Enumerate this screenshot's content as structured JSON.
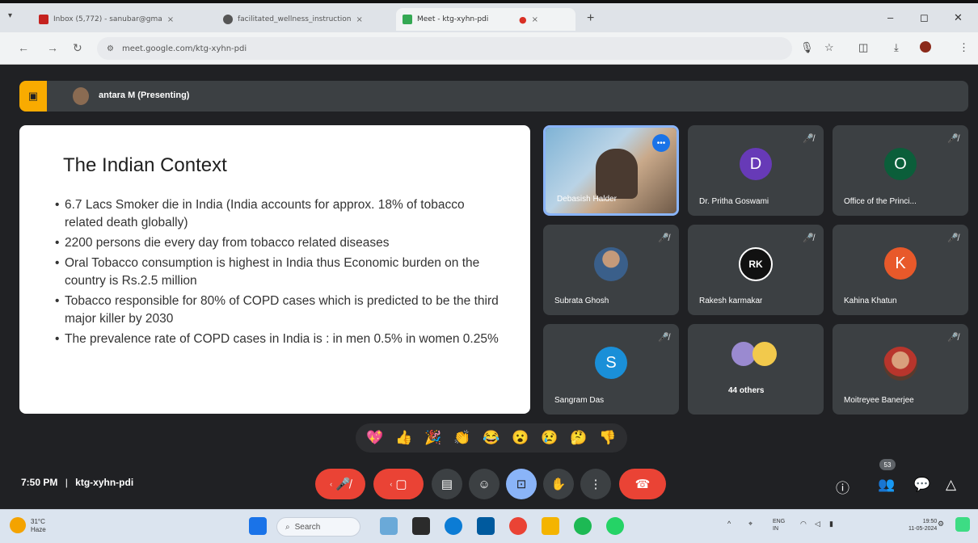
{
  "browser": {
    "tabs": [
      {
        "title": "Inbox (5,772) - sanubar@gma",
        "close": "×",
        "favicon_color": "#c5221f"
      },
      {
        "title": "facilitated_wellness_instruction",
        "close": "×",
        "favicon_color": "#555555"
      },
      {
        "title": "Meet - ktg-xyhn-pdi",
        "close": "×",
        "favicon_color": "#34a853"
      }
    ],
    "new_tab": "+",
    "minimize": "–",
    "restore": "◻",
    "close": "✕",
    "url": "meet.google.com/ktg-xyhn-pdi"
  },
  "meet": {
    "presenter_label": "antara M (Presenting)",
    "slide": {
      "title": "The Indian Context",
      "bullets": [
        "6.7 Lacs Smoker die in India (India accounts for approx. 18% of tobacco related death globally)",
        "2200 persons die every day from tobacco related diseases",
        "Oral Tobacco consumption is highest in India thus Economic burden on the country is Rs.2.5 million",
        "Tobacco responsible for 80% of COPD cases which is predicted to be the third major killer by 2030",
        "The prevalence rate of COPD cases in India is : in men 0.5% in women 0.25%"
      ]
    },
    "participants": [
      {
        "name": "Debasish Halder",
        "avatar": "photo",
        "speaking": true
      },
      {
        "name": "Dr. Pritha Goswami",
        "letter": "D",
        "color": "#673ab7"
      },
      {
        "name": "Office of the Princi...",
        "letter": "O",
        "color": "#0b5e3a"
      },
      {
        "name": "Subrata Ghosh",
        "avatar": "photo"
      },
      {
        "name": "Rakesh karmakar",
        "avatar": "logo",
        "logo_text": "RK"
      },
      {
        "name": "Kahina Khatun",
        "letter": "K",
        "color": "#e8592a"
      },
      {
        "name": "Sangram Das",
        "letter": "S",
        "color": "#1a8fd8"
      },
      {
        "name": "44 others",
        "avatar": "group"
      },
      {
        "name": "Moitreyee Banerjee",
        "avatar": "photo"
      }
    ],
    "reactions": [
      "💖",
      "👍",
      "🎉",
      "👏",
      "😂",
      "😮",
      "😢",
      "🤔",
      "👎"
    ],
    "time": "7:50 PM",
    "separator": "|",
    "meeting_code": "ktg-xyhn-pdi",
    "participant_count": "53"
  },
  "taskbar": {
    "temp": "31°C",
    "weather": "Haze",
    "search_placeholder": "Search",
    "lang_top": "ENG",
    "lang_bottom": "IN",
    "clock_time": "19:50",
    "clock_date": "11-05-2024"
  }
}
